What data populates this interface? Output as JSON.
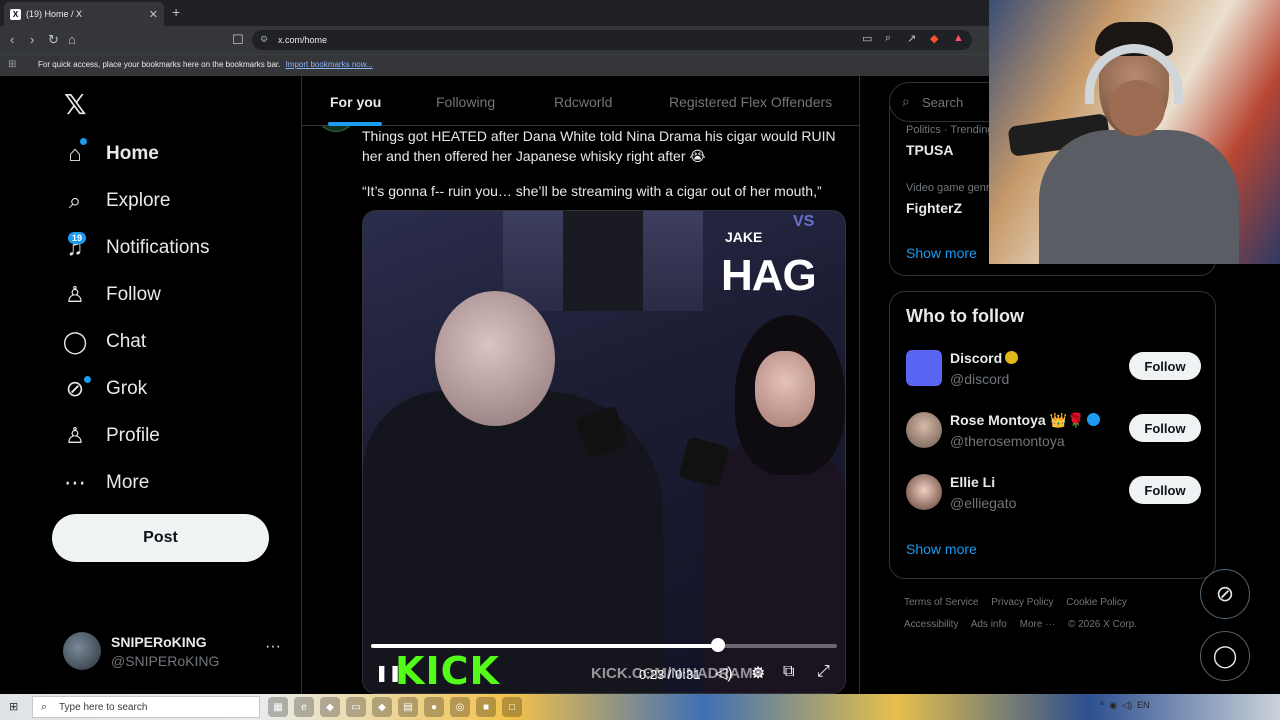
{
  "browser": {
    "tab_title": "(19) Home / X",
    "tab_close": "✕",
    "new_tab": "+",
    "url": "x.com/home",
    "bookmarks_text": "For quick access, place your bookmarks here on the bookmarks bar.",
    "bookmarks_link": "Import bookmarks now..."
  },
  "nav": {
    "items": [
      {
        "label": "Home",
        "icon": "home-icon",
        "glyph": "⌂"
      },
      {
        "label": "Explore",
        "icon": "search-icon",
        "glyph": "⌕"
      },
      {
        "label": "Notifications",
        "icon": "bell-icon",
        "glyph": "🔔"
      },
      {
        "label": "Follow",
        "icon": "person-add-icon",
        "glyph": "👤"
      },
      {
        "label": "Chat",
        "icon": "chat-icon",
        "glyph": "◯"
      },
      {
        "label": "Grok",
        "icon": "grok-icon",
        "glyph": "⊘"
      },
      {
        "label": "Profile",
        "icon": "profile-icon",
        "glyph": "♙"
      },
      {
        "label": "More",
        "icon": "more-circle-icon",
        "glyph": "⋯"
      }
    ],
    "notifications_count": "19",
    "post_label": "Post",
    "account_name": "SNIPERoKING",
    "account_handle": "@SNIPERoKING",
    "account_more": "···"
  },
  "feed": {
    "tabs": [
      "For you",
      "Following",
      "Rdcworld",
      "Registered Flex Offenders"
    ],
    "post_text": "Things got HEATED after Dana White told Nina Drama his cigar would RUIN her and then offered her Japanese whisky right after 😭",
    "post_quote": "“It’s gonna f-- ruin you… she’ll be streaming with a cigar out of her mouth,”",
    "video": {
      "overlay_jake": "JAKE",
      "overlay_vs": "VS",
      "overlay_hag": "HAG",
      "kick_logo": "KICK",
      "kick_url": "KICK.COM/NINADRAMA",
      "time": "0:23 / 0:31",
      "progress": 0.745
    }
  },
  "sidebar": {
    "search_placeholder": "Search",
    "trends": [
      {
        "meta": "Politics · Trending",
        "name": "TPUSA"
      },
      {
        "meta": "Video game genre",
        "name": "FighterZ"
      }
    ],
    "show_more": "Show more",
    "who_to_follow_title": "Who to follow",
    "follow_users": [
      {
        "name": "Discord",
        "handle": "@discord",
        "badge": "gold",
        "button": "Follow"
      },
      {
        "name": "Rose Montoya 👑🌹",
        "handle": "@therosemontoya",
        "badge": "blue",
        "button": "Follow"
      },
      {
        "name": "Ellie Li",
        "handle": "@elliegato",
        "badge": "",
        "button": "Follow"
      }
    ],
    "show_more_2": "Show more",
    "footer": [
      "Terms of Service",
      "Privacy Policy",
      "Cookie Policy",
      "Accessibility",
      "Ads info",
      "More ···",
      "© 2026 X Corp."
    ]
  },
  "taskbar": {
    "search_placeholder": "Type here to search",
    "tray": "EN"
  },
  "colors": {
    "accent": "#1d9bf0",
    "background": "#000000",
    "kick_green": "#53fc18"
  }
}
